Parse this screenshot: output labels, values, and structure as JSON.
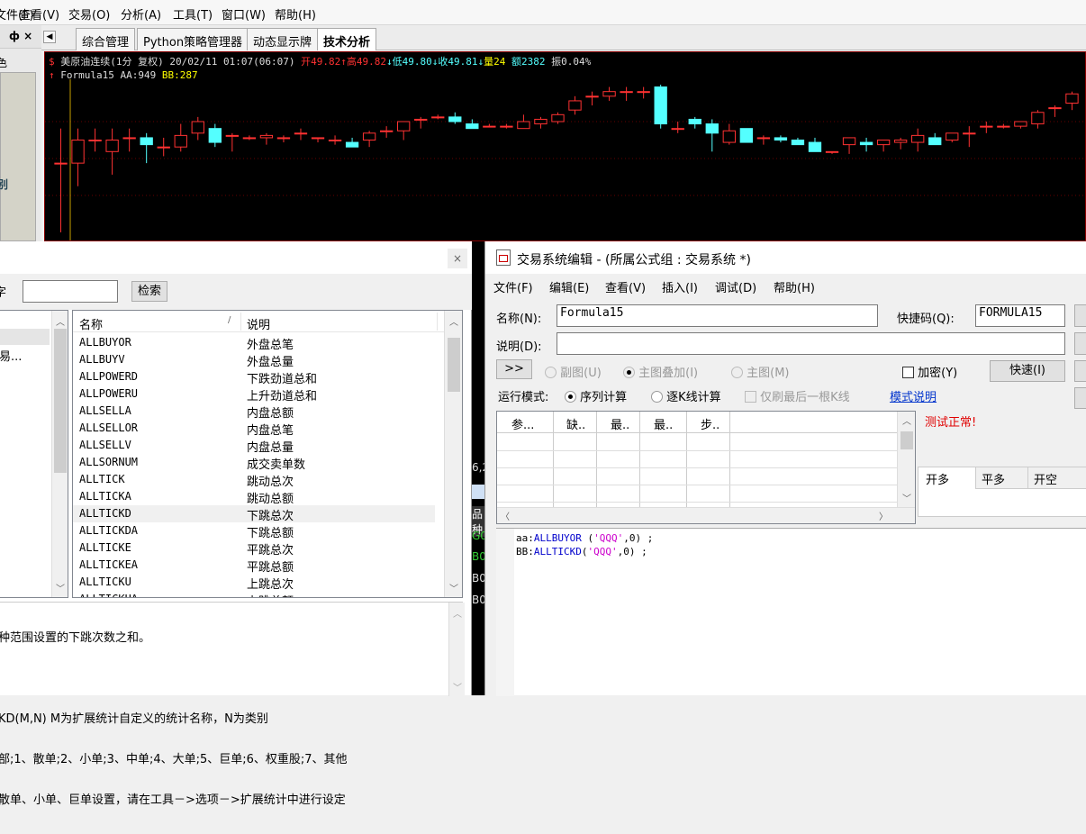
{
  "menu": [
    "文件(F)",
    "查看(V)",
    "交易(O)",
    "分析(A)",
    "工具(T)",
    "窗口(W)",
    "帮助(H)"
  ],
  "left_strip": {
    "pin": "ф ×",
    "mark": "色",
    "label": "别"
  },
  "tabs": [
    "综合管理",
    "Python策略管理器",
    "动态显示牌",
    "技术分析"
  ],
  "active_tab": 3,
  "quote": {
    "symbol": "美原油连续(1分 复权)",
    "datetime": "20/02/11 01:07(06:07)",
    "open": "开49.82",
    "high": "高49.82",
    "low": "低49.80",
    "close": "收49.81",
    "volume": "量24",
    "amount": "额2382",
    "amplitude": "振0.04%",
    "formula_name": "Formula15",
    "aa": "AA:949",
    "bb": "BB:287"
  },
  "chart_data": {
    "type": "candlestick",
    "series": [
      {
        "o": 49.795,
        "h": 49.81,
        "l": 49.765,
        "c": 49.795
      },
      {
        "o": 49.795,
        "h": 49.81,
        "l": 49.785,
        "c": 49.805
      },
      {
        "o": 49.805,
        "h": 49.81,
        "l": 49.8,
        "c": 49.805
      },
      {
        "o": 49.8,
        "h": 49.81,
        "l": 49.79,
        "c": 49.805
      },
      {
        "o": 49.806,
        "h": 49.81,
        "l": 49.8,
        "c": 49.806
      },
      {
        "o": 49.806,
        "h": 49.808,
        "l": 49.795,
        "c": 49.803
      },
      {
        "o": 49.802,
        "h": 49.806,
        "l": 49.798,
        "c": 49.802
      },
      {
        "o": 49.802,
        "h": 49.812,
        "l": 49.8,
        "c": 49.807
      },
      {
        "o": 49.808,
        "h": 49.815,
        "l": 49.805,
        "c": 49.813
      },
      {
        "o": 49.81,
        "h": 49.812,
        "l": 49.802,
        "c": 49.804
      },
      {
        "o": 49.807,
        "h": 49.808,
        "l": 49.8,
        "c": 49.807
      },
      {
        "o": 49.806,
        "h": 49.807,
        "l": 49.805,
        "c": 49.806
      },
      {
        "o": 49.806,
        "h": 49.808,
        "l": 49.803,
        "c": 49.807
      },
      {
        "o": 49.806,
        "h": 49.807,
        "l": 49.804,
        "c": 49.806
      },
      {
        "o": 49.808,
        "h": 49.81,
        "l": 49.805,
        "c": 49.808
      },
      {
        "o": 49.806,
        "h": 49.806,
        "l": 49.804,
        "c": 49.806
      },
      {
        "o": 49.805,
        "h": 49.807,
        "l": 49.803,
        "c": 49.805
      },
      {
        "o": 49.804,
        "h": 49.806,
        "l": 49.802,
        "c": 49.802
      },
      {
        "o": 49.805,
        "h": 49.809,
        "l": 49.802,
        "c": 49.808
      },
      {
        "o": 49.809,
        "h": 49.811,
        "l": 49.806,
        "c": 49.809
      },
      {
        "o": 49.809,
        "h": 49.813,
        "l": 49.805,
        "c": 49.813
      },
      {
        "o": 49.814,
        "h": 49.815,
        "l": 49.81,
        "c": 49.814
      },
      {
        "o": 49.815,
        "h": 49.816,
        "l": 49.814,
        "c": 49.815
      },
      {
        "o": 49.815,
        "h": 49.817,
        "l": 49.812,
        "c": 49.813
      },
      {
        "o": 49.812,
        "h": 49.814,
        "l": 49.81,
        "c": 49.81
      },
      {
        "o": 49.811,
        "h": 49.812,
        "l": 49.811,
        "c": 49.811
      },
      {
        "o": 49.811,
        "h": 49.812,
        "l": 49.81,
        "c": 49.811
      },
      {
        "o": 49.81,
        "h": 49.816,
        "l": 49.81,
        "c": 49.813
      },
      {
        "o": 49.812,
        "h": 49.815,
        "l": 49.81,
        "c": 49.814
      },
      {
        "o": 49.813,
        "h": 49.817,
        "l": 49.812,
        "c": 49.816
      },
      {
        "o": 49.818,
        "h": 49.824,
        "l": 49.816,
        "c": 49.822
      },
      {
        "o": 49.824,
        "h": 49.826,
        "l": 49.82,
        "c": 49.824
      },
      {
        "o": 49.824,
        "h": 49.828,
        "l": 49.822,
        "c": 49.826
      },
      {
        "o": 49.826,
        "h": 49.828,
        "l": 49.822,
        "c": 49.826
      },
      {
        "o": 49.826,
        "h": 49.828,
        "l": 49.823,
        "c": 49.826
      },
      {
        "o": 49.828,
        "h": 49.829,
        "l": 49.81,
        "c": 49.812
      },
      {
        "o": 49.81,
        "h": 49.813,
        "l": 49.808,
        "c": 49.81
      },
      {
        "o": 49.814,
        "h": 49.815,
        "l": 49.81,
        "c": 49.812
      },
      {
        "o": 49.812,
        "h": 49.814,
        "l": 49.8,
        "c": 49.808
      },
      {
        "o": 49.804,
        "h": 49.812,
        "l": 49.803,
        "c": 49.809
      },
      {
        "o": 49.81,
        "h": 49.81,
        "l": 49.804,
        "c": 49.804
      },
      {
        "o": 49.806,
        "h": 49.807,
        "l": 49.803,
        "c": 49.806
      },
      {
        "o": 49.806,
        "h": 49.807,
        "l": 49.804,
        "c": 49.805
      },
      {
        "o": 49.805,
        "h": 49.806,
        "l": 49.803,
        "c": 49.803
      },
      {
        "o": 49.804,
        "h": 49.806,
        "l": 49.8,
        "c": 49.8
      },
      {
        "o": 49.8,
        "h": 49.8,
        "l": 49.799,
        "c": 49.8
      },
      {
        "o": 49.803,
        "h": 49.805,
        "l": 49.799,
        "c": 49.806
      },
      {
        "o": 49.804,
        "h": 49.806,
        "l": 49.8,
        "c": 49.803
      },
      {
        "o": 49.803,
        "h": 49.805,
        "l": 49.8,
        "c": 49.805
      },
      {
        "o": 49.804,
        "h": 49.806,
        "l": 49.801,
        "c": 49.805
      },
      {
        "o": 49.804,
        "h": 49.81,
        "l": 49.8,
        "c": 49.807
      },
      {
        "o": 49.806,
        "h": 49.808,
        "l": 49.803,
        "c": 49.803
      },
      {
        "o": 49.805,
        "h": 49.808,
        "l": 49.804,
        "c": 49.808
      },
      {
        "o": 49.808,
        "h": 49.811,
        "l": 49.802,
        "c": 49.808
      },
      {
        "o": 49.811,
        "h": 49.813,
        "l": 49.808,
        "c": 49.811
      },
      {
        "o": 49.811,
        "h": 49.812,
        "l": 49.81,
        "c": 49.811
      },
      {
        "o": 49.811,
        "h": 49.813,
        "l": 49.81,
        "c": 49.813
      },
      {
        "o": 49.812,
        "h": 49.818,
        "l": 49.81,
        "c": 49.817
      },
      {
        "o": 49.819,
        "h": 49.82,
        "l": 49.815,
        "c": 49.819
      },
      {
        "o": 49.821,
        "h": 49.826,
        "l": 49.818,
        "c": 49.825
      }
    ],
    "up_color": "#ff3232",
    "down_color": "#54ffff"
  },
  "left_dialog": {
    "field_label": "字",
    "search_button": "检索",
    "tree_item": "易...",
    "columns": [
      "名称",
      "说明"
    ],
    "rows": [
      [
        "ALLBUYOR",
        "外盘总笔"
      ],
      [
        "ALLBUYV",
        "外盘总量"
      ],
      [
        "ALLPOWERD",
        "下跌劲道总和"
      ],
      [
        "ALLPOWERU",
        "上升劲道总和"
      ],
      [
        "ALLSELLA",
        "内盘总额"
      ],
      [
        "ALLSELLOR",
        "内盘总笔"
      ],
      [
        "ALLSELLV",
        "内盘总量"
      ],
      [
        "ALLSORNUM",
        "成交卖单数"
      ],
      [
        "ALLTICK",
        "跳动总次"
      ],
      [
        "ALLTICKA",
        "跳动总额"
      ],
      [
        "ALLTICKD",
        "下跳总次"
      ],
      [
        "ALLTICKDA",
        "下跳总额"
      ],
      [
        "ALLTICKE",
        "平跳总次"
      ],
      [
        "ALLTICKEA",
        "平跳总额"
      ],
      [
        "ALLTICKU",
        "上跳总次"
      ],
      [
        "ALLTICKUA",
        "上跳总额"
      ]
    ],
    "selected_row": 10,
    "description": [
      "种范围设置的下跳次数之和。",
      "",
      "KD(M,N) M为扩展统计自定义的统计名称，N为类别",
      "部;1、散单;2、小单;3、中单;4、大单;5、巨单;6、权重股;7、其他",
      "散单、小单、巨单设置，请在工具－>选项－>扩展统计中进行设定"
    ]
  },
  "right_dialog": {
    "title": "交易系统编辑 - (所属公式组 : 交易系统 *)",
    "menu": [
      "文件(F)",
      "编辑(E)",
      "查看(V)",
      "插入(I)",
      "调试(D)",
      "帮助(H)"
    ],
    "name_label": "名称(N):",
    "name_value": "Formula15",
    "shortcut_label": "快捷码(Q):",
    "shortcut_value": "FORMULA15",
    "desc_label": "说明(D):",
    "expand_button": ">>",
    "radio_sub": "副图(U)",
    "radio_overlay": "主图叠加(I)",
    "radio_main": "主图(M)",
    "encrypt_label": "加密(Y)",
    "quick_button": "快速(I)",
    "run_mode_label": "运行模式:",
    "mode_seq": "序列计算",
    "mode_kline": "逐K线计算",
    "only_last": "仅刷最后一根K线",
    "mode_help": "模式说明",
    "param_columns": [
      "参...",
      "缺..",
      "最..",
      "最..",
      "步.."
    ],
    "test_status": "测试正常!",
    "signal_tabs": [
      "开多",
      "平多",
      "开空"
    ],
    "code_lines": [
      {
        "var": "aa:",
        "func": "ALLBUYOR",
        "arg": "'QQQ'",
        "rest": ",0) ;"
      },
      {
        "var": "BB:",
        "func": "ALLTICKD",
        "arg": "'QQQ'",
        "rest": ",0) ;"
      }
    ]
  },
  "mid_fragments": [
    "6,2",
    "品种",
    "G0",
    "B0",
    "B0",
    "B0"
  ],
  "colors": {
    "chart_bg": "#000000",
    "up": "#ff3232",
    "down": "#54ffff",
    "status_ok": "#e00000",
    "link": "#0033cc"
  }
}
